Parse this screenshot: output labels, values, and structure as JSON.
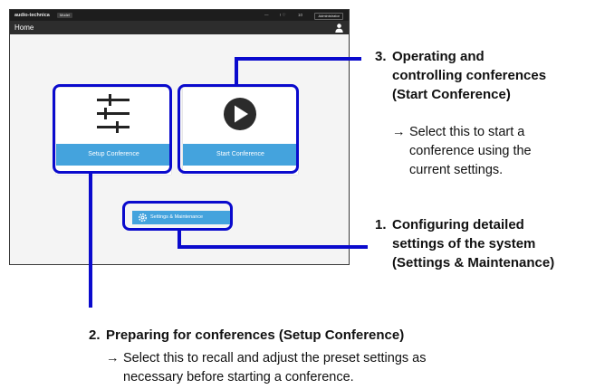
{
  "screen": {
    "topbar": {
      "logo": "audio-technica",
      "model": "Model",
      "status1": "—",
      "status2": "! ♡",
      "status3": "10",
      "user_button": "Administrator"
    },
    "title": "Home",
    "tiles": {
      "setup": {
        "icon": "sliders-icon",
        "label": "Setup Conference"
      },
      "start": {
        "icon": "play-icon",
        "label": "Start Conference"
      }
    },
    "settings_button": {
      "icon": "gear-icon",
      "label": "Settings & Maintenance"
    },
    "colors": {
      "accent": "#44a3dd",
      "header": "#2d2d2d",
      "topbar": "#1d1d1d"
    }
  },
  "callouts": {
    "c3": {
      "number": "3.",
      "heading": [
        "Operating and",
        "controlling conferences",
        "(Start Conference)"
      ],
      "arrow": "→",
      "description": [
        "Select this to start a",
        "conference using the",
        "current settings."
      ]
    },
    "c1": {
      "number": "1.",
      "heading": [
        "Configuring detailed",
        "settings of the system",
        "(Settings & Maintenance)"
      ]
    },
    "c2": {
      "number": "2.",
      "heading": "Preparing for conferences (Setup Conference)",
      "arrow": "→",
      "description": [
        "Select this to recall and adjust the preset settings as",
        "necessary before starting a conference."
      ]
    }
  },
  "highlight_color": "#0a0acd"
}
